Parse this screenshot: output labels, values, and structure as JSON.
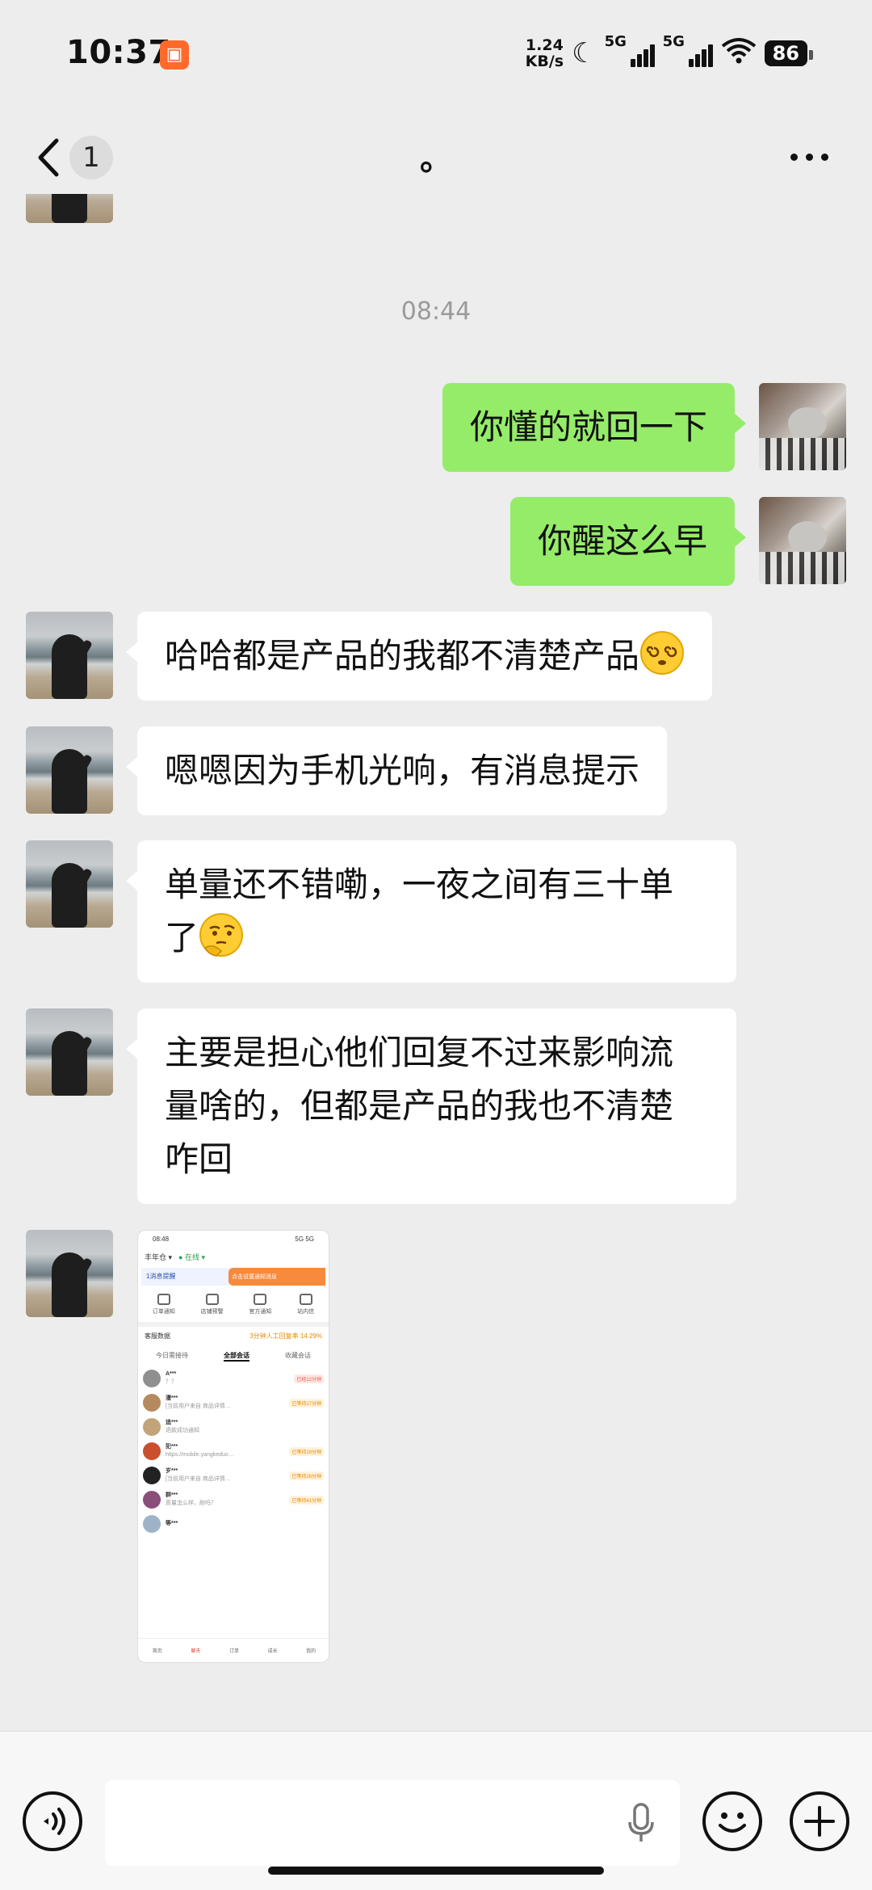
{
  "status_bar": {
    "time": "10:37",
    "net_speed_value": "1.24",
    "net_speed_unit": "KB/s",
    "sim1_label": "5G",
    "sim2_label": "5G",
    "battery": "86",
    "icons": [
      "app-notification-icon",
      "moon-icon",
      "signal-icon",
      "signal-icon",
      "wifi-icon",
      "battery-icon"
    ]
  },
  "nav": {
    "unread_count": "1",
    "title": "。"
  },
  "chat": {
    "timestamp": "08:44",
    "messages": [
      {
        "side": "out",
        "text": "你懂的就回一下"
      },
      {
        "side": "out",
        "text": "你醒这么早"
      },
      {
        "side": "in",
        "text": "哈哈都是产品的我都不清楚产品",
        "emoji": "dizzy-face"
      },
      {
        "side": "in",
        "text": "嗯嗯因为手机光响，有消息提示"
      },
      {
        "side": "in",
        "text_line1": "单量还不错嘞，一夜之间有三十单",
        "text_line2": "了",
        "emoji": "thinking-face"
      },
      {
        "side": "in",
        "text_line1": "主要是担心他们回复不过来影响流",
        "text_line2": "量啥的，但都是产品的我也不清楚",
        "text_line3": "咋回"
      },
      {
        "side": "in",
        "type": "image"
      }
    ]
  },
  "shared_screenshot": {
    "time": "08:48",
    "status_right": "5G 5G",
    "shop": "丰年仓 ▾",
    "status": "● 在线 ▾",
    "notice_left": "1消息提醒",
    "notice_right": "点击设置通知消息",
    "tools": [
      "订单通知",
      "店铺预警",
      "官方通知",
      "站内信"
    ],
    "data_label": "客服数据",
    "data_value": "3分钟人工回复率 14.29%",
    "tabs": [
      "今日需接待",
      "全部会话",
      "收藏会话"
    ],
    "rows": [
      {
        "name": "A***",
        "msg": "？？",
        "tag": "已经12分钟"
      },
      {
        "name": "漫***",
        "msg": "[当前用户来自 商品详情…",
        "tag": "已等待17分钟"
      },
      {
        "name": "追***",
        "msg": "退款成功通知",
        "tag": ""
      },
      {
        "name": "犯***",
        "msg": "https://mobile.yangkeduo…",
        "tag": "已等待19分钟"
      },
      {
        "name": "岁***",
        "msg": "[当前用户来自 商品详情…",
        "tag": "已等待26分钟"
      },
      {
        "name": "群***",
        "msg": "质量怎么样，耐吗？",
        "tag": "已等待41分钟"
      },
      {
        "name": "等***",
        "msg": "",
        "tag": ""
      }
    ],
    "bottom_nav": [
      "首页",
      "聊天",
      "订单",
      "成长",
      "我的"
    ]
  },
  "input_bar": {
    "placeholder": ""
  },
  "colors": {
    "background": "#ededed",
    "outgoing_bubble": "#95ec69",
    "incoming_bubble": "#ffffff",
    "timestamp": "#9a9a9a"
  }
}
